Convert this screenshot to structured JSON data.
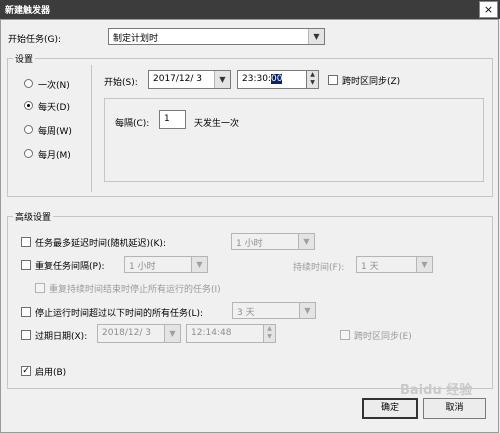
{
  "window": {
    "title": "新建触发器",
    "close": "×"
  },
  "start_task": {
    "label": "开始任务(G):",
    "value": "制定计划时"
  },
  "settings": {
    "group_label": "设置",
    "schedule_options": [
      {
        "label": "一次(N)",
        "selected": false
      },
      {
        "label": "每天(D)",
        "selected": true
      },
      {
        "label": "每周(W)",
        "selected": false
      },
      {
        "label": "每月(M)",
        "selected": false
      }
    ],
    "start": {
      "label": "开始(S):",
      "date": "2017/12/ 3",
      "time_prefix": "23:30:",
      "time_selected": "00",
      "sync_label": "跨时区同步(Z)"
    },
    "recur": {
      "label": "每隔(C):",
      "value": "1",
      "suffix": "天发生一次"
    }
  },
  "advanced": {
    "group_label": "高级设置",
    "delay": {
      "label": "任务最多延迟时间(随机延迟)(K):",
      "value": "1 小时"
    },
    "repeat": {
      "label": "重复任务间隔(P):",
      "value": "1 小时",
      "duration_label": "持续时间(F):",
      "duration_value": "1 天",
      "stop_label": "重复持续时间结束时停止所有运行的任务(I)"
    },
    "stop_longer": {
      "label": "停止运行时间超过以下时间的所有任务(L):",
      "value": "3 天"
    },
    "expire": {
      "label": "过期日期(X):",
      "date": "2018/12/ 3",
      "time": "12:14:48",
      "sync_label": "跨时区同步(E)"
    },
    "enabled": {
      "label": "启用(B)",
      "checked": true
    }
  },
  "buttons": {
    "ok": "确定",
    "cancel": "取消"
  },
  "watermark": "Baidu 经验"
}
